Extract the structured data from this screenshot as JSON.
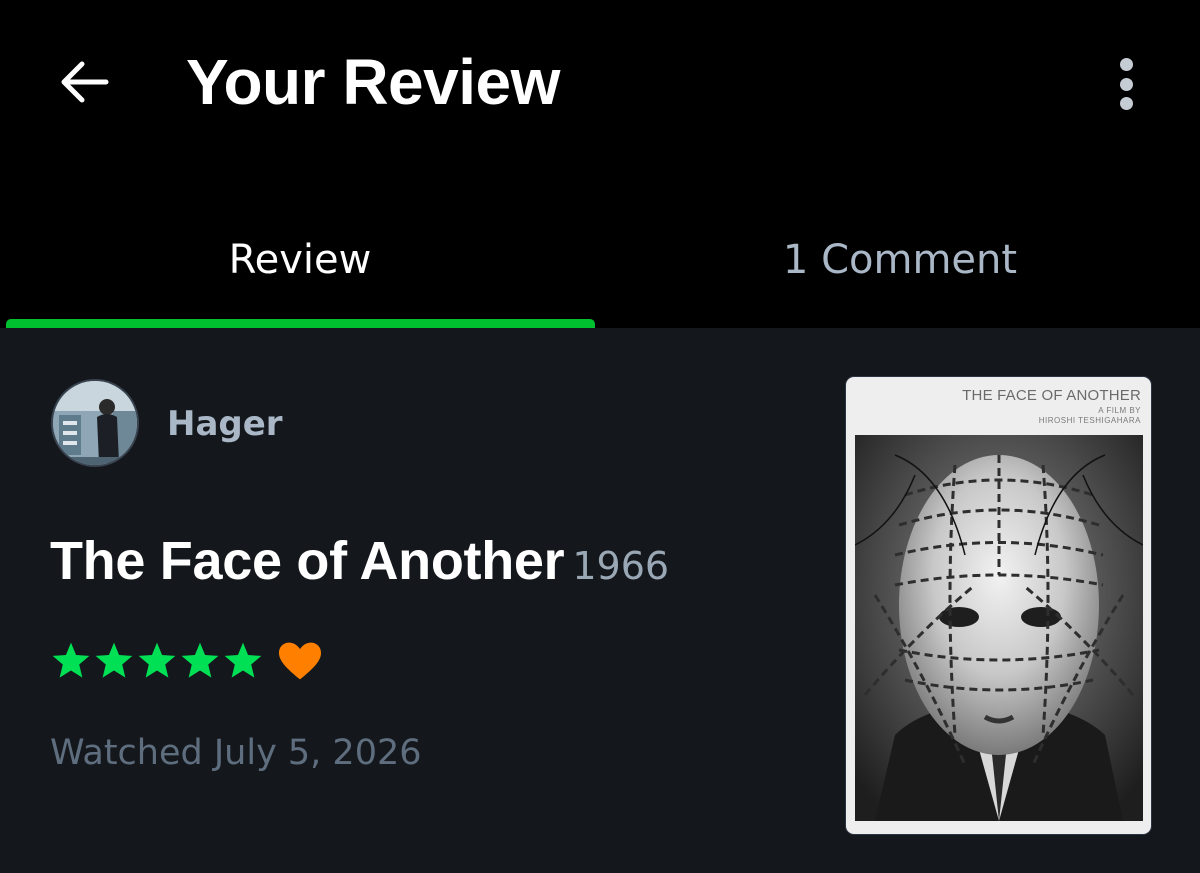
{
  "header": {
    "title": "Your Review",
    "back_icon": "arrow-left-icon",
    "menu_icon": "more-vertical-icon"
  },
  "tabs": [
    {
      "label": "Review",
      "active": true
    },
    {
      "label": "1 Comment",
      "active": false
    }
  ],
  "reviewer": {
    "name": "Hager"
  },
  "film": {
    "title": "The Face of Another",
    "year": "1966",
    "rating_stars": 5,
    "liked": true,
    "watched": "Watched July 5, 2026"
  },
  "poster": {
    "title": "THE FACE OF ANOTHER",
    "line1": "A FILM BY",
    "line2": "HIROSHI TESHIGAHARA"
  },
  "colors": {
    "accent_green": "#00c030",
    "star_green": "#00e054",
    "heart_orange": "#ff8000",
    "background": "#14181c"
  }
}
